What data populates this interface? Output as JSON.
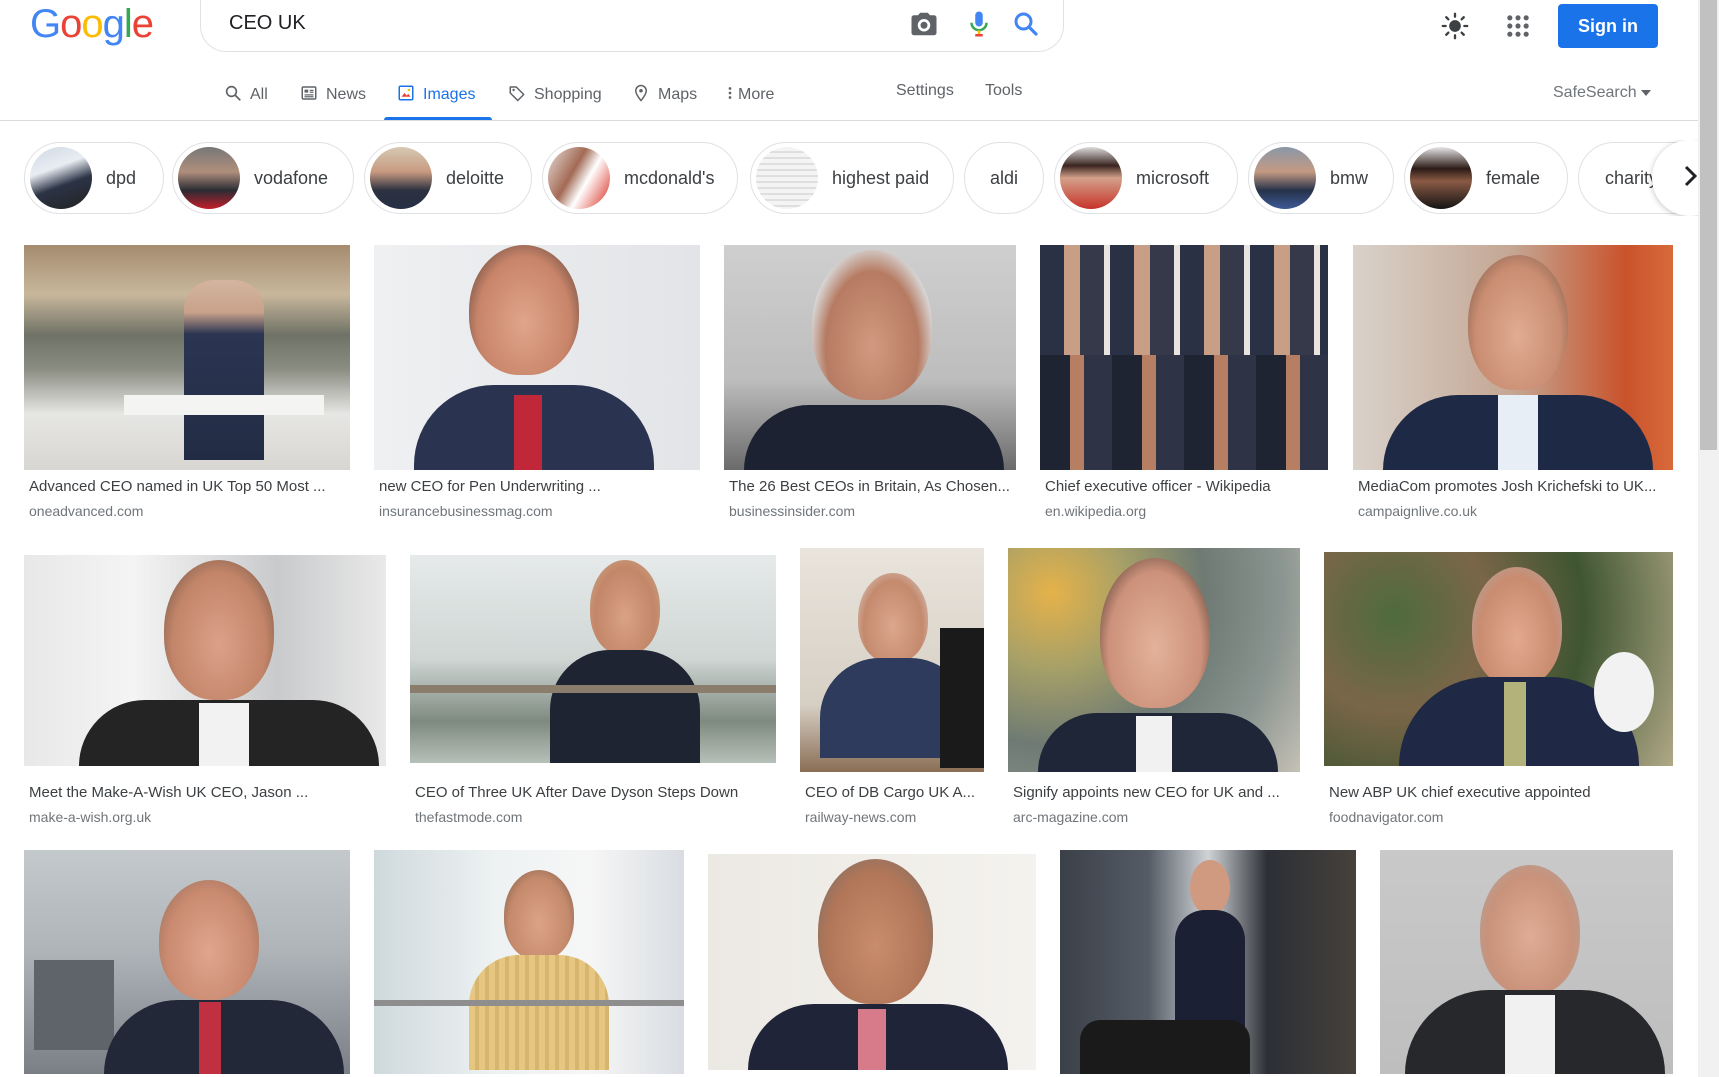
{
  "logo": {
    "letters": [
      "G",
      "o",
      "o",
      "g",
      "l",
      "e"
    ],
    "colors": [
      "#4285f4",
      "#ea4335",
      "#fbbc05",
      "#4285f4",
      "#34a853",
      "#ea4335"
    ]
  },
  "search": {
    "query": "CEO UK",
    "icons": [
      "camera-icon",
      "mic-icon",
      "search-icon"
    ]
  },
  "header": {
    "signin_label": "Sign in",
    "accent": "#1a73e8"
  },
  "tabs": [
    {
      "label": "All",
      "icon": "search-icon"
    },
    {
      "label": "News",
      "icon": "news-icon"
    },
    {
      "label": "Images",
      "icon": "images-icon",
      "active": true
    },
    {
      "label": "Shopping",
      "icon": "tag-icon"
    },
    {
      "label": "Maps",
      "icon": "map-pin-icon"
    },
    {
      "label": "More",
      "icon": "more-vert-icon"
    }
  ],
  "tab_links": {
    "settings": "Settings",
    "tools": "Tools"
  },
  "safesearch": {
    "label": "SafeSearch"
  },
  "chips": [
    {
      "label": "dpd"
    },
    {
      "label": "vodafone"
    },
    {
      "label": "deloitte"
    },
    {
      "label": "mcdonald's"
    },
    {
      "label": "highest paid"
    },
    {
      "label": "aldi"
    },
    {
      "label": "microsoft"
    },
    {
      "label": "bmw"
    },
    {
      "label": "female"
    },
    {
      "label": "charity"
    }
  ],
  "results": [
    {
      "title": "Advanced CEO named in UK Top 50 Most ...",
      "source": "oneadvanced.com"
    },
    {
      "title": "new CEO for Pen Underwriting ...",
      "source": "insurancebusinessmag.com"
    },
    {
      "title": "The 26 Best CEOs in Britain, As Chosen...",
      "source": "businessinsider.com"
    },
    {
      "title": "Chief executive officer - Wikipedia",
      "source": "en.wikipedia.org"
    },
    {
      "title": "MediaCom promotes Josh Krichefski to UK...",
      "source": "campaignlive.co.uk"
    },
    {
      "title": "Meet the Make-A-Wish UK CEO, Jason ...",
      "source": "make-a-wish.org.uk"
    },
    {
      "title": "CEO of Three UK After Dave Dyson Steps Down",
      "source": "thefastmode.com"
    },
    {
      "title": "CEO of DB Cargo UK A...",
      "source": "railway-news.com"
    },
    {
      "title": "Signify appoints new CEO for UK and ...",
      "source": "arc-magazine.com"
    },
    {
      "title": "New ABP UK chief executive appointed",
      "source": "foodnavigator.com"
    },
    {
      "title": "",
      "source": ""
    },
    {
      "title": "",
      "source": ""
    },
    {
      "title": "",
      "source": ""
    },
    {
      "title": "",
      "source": ""
    },
    {
      "title": "",
      "source": ""
    }
  ]
}
